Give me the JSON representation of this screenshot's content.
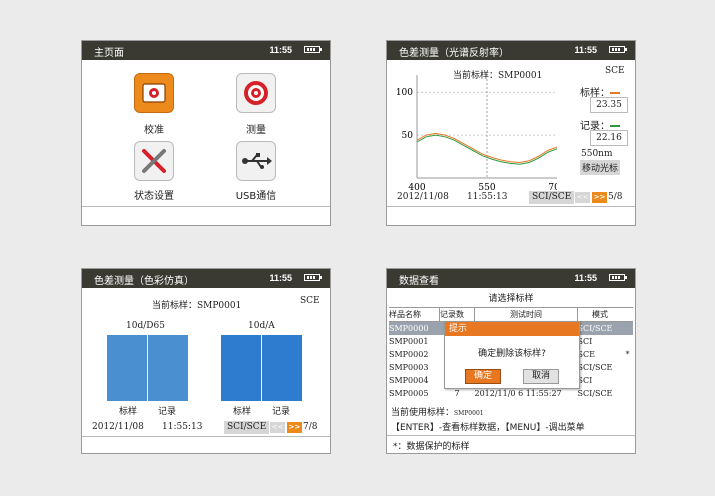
{
  "battery_icon": "battery-icon",
  "colors": {
    "titlebar": "#3a3a33",
    "accent": "#e87722",
    "bar": "#4a8fcf",
    "selected_row": "#9aa3ad"
  },
  "main_menu": {
    "title": "主页面",
    "time": "11:55",
    "items": [
      {
        "label": "校准",
        "icon": "calibrate-icon"
      },
      {
        "label": "测量",
        "icon": "measure-target-icon"
      },
      {
        "label": "状态设置",
        "icon": "tools-icon"
      },
      {
        "label": "USB通信",
        "icon": "usb-icon"
      }
    ]
  },
  "reflectance": {
    "title": "色差测量（光谱反射率）",
    "time": "11:55",
    "current_standard": "当前标样：SMP0001",
    "mode": "SCE",
    "standard_label": "标样：",
    "standard_value": "23.35",
    "record_label": "记录：",
    "record_value": "22.16",
    "wavelength": "550nm",
    "move_cursor_button": "移动光标",
    "date": "2012/11/08",
    "clock": "11:55:13",
    "sci_sce": "SCI/SCE",
    "prev": "<<",
    "next": ">>",
    "page": "5/8",
    "chart_data": {
      "type": "line",
      "x_ticks": [
        "400",
        "550",
        "700"
      ],
      "y_ticks": [
        "100",
        "50"
      ],
      "xlim": [
        400,
        700
      ],
      "ylim": [
        0,
        120
      ],
      "cursor_x": 550,
      "series": [
        {
          "color": "#e87722",
          "x": [
            400,
            420,
            440,
            460,
            480,
            500,
            520,
            540,
            560,
            580,
            600,
            620,
            640,
            660,
            680,
            700
          ],
          "values": [
            44,
            50,
            52,
            50,
            46,
            40,
            34,
            28,
            24,
            21,
            19,
            18,
            20,
            25,
            32,
            36
          ]
        },
        {
          "color": "#2c9a3c",
          "x": [
            400,
            420,
            440,
            460,
            480,
            500,
            520,
            540,
            560,
            580,
            600,
            620,
            640,
            660,
            680,
            700
          ],
          "values": [
            42,
            48,
            50,
            48,
            44,
            38,
            32,
            26,
            22,
            19,
            17,
            16,
            18,
            23,
            30,
            34
          ]
        }
      ]
    }
  },
  "simulation": {
    "title": "色差测量（色彩仿真）",
    "time": "11:55",
    "current_standard": "当前标样：SMP0001",
    "mode": "SCE",
    "illum1": "10d/D65",
    "illum2": "10d/A",
    "standard": "标样",
    "record": "记录",
    "date": "2012/11/08",
    "clock": "11:55:13",
    "sci_sce": "SCI/SCE",
    "prev": "<<",
    "next": ">>",
    "page": "7/8"
  },
  "data_view": {
    "title": "数据查看",
    "time": "11:55",
    "select_prompt": "请选择标样",
    "headers": [
      "样品名称",
      "记录数",
      "测试时间",
      "模式"
    ],
    "rows": [
      {
        "name": "SMP0000",
        "count": "",
        "time": "",
        "mode": "SCI/SCE",
        "flag": ""
      },
      {
        "name": "SMP0001",
        "count": "",
        "time": "",
        "mode": "SCI",
        "flag": ""
      },
      {
        "name": "SMP0002",
        "count": "",
        "time": "",
        "mode": "SCE",
        "flag": "*"
      },
      {
        "name": "SMP0003",
        "count": "",
        "time": "",
        "mode": "SCI/SCE",
        "flag": ""
      },
      {
        "name": "SMP0004",
        "count": "",
        "time": "",
        "mode": "SCI",
        "flag": ""
      },
      {
        "name": "SMP0005",
        "count": "7",
        "time": "2012/11/0 6 11:55:27",
        "mode": "SCI/SCE",
        "flag": ""
      }
    ],
    "dialog_title": "提示",
    "dialog_message": "确定删除该标样?",
    "ok": "确定",
    "cancel": "取消",
    "current_label": "当前使用标样：",
    "current_value": "SMP0001",
    "hint": "【ENTER】-查看标样数据，【MENU】-调出菜单",
    "footnote": "*：数据保护的标样"
  }
}
